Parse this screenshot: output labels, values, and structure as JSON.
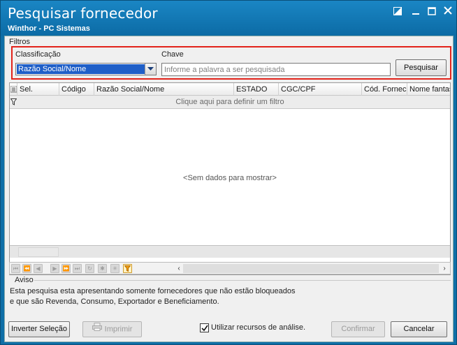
{
  "window": {
    "title": "Pesquisar fornecedor",
    "subtitle": "Winthor - PC Sistemas",
    "controls": {
      "restore": "◩",
      "minimize": "—",
      "maximize": "☐",
      "close": "✕"
    }
  },
  "filtros": {
    "group_label": "Filtros",
    "classificacao_label": "Classificação",
    "classificacao_value": "Razão Social/Nome",
    "chave_label": "Chave",
    "chave_placeholder": "Informe a palavra a ser pesquisada",
    "chave_value": "",
    "pesquisar_label": "Pesquisar"
  },
  "grid": {
    "columns": [
      "Sel.",
      "Código",
      "Razão Social/Nome",
      "ESTADO",
      "CGC/CPF",
      "Cód. Fornec",
      "Nome fantasia"
    ],
    "filter_prompt": "Clique aqui para definir um filtro",
    "empty_message": "<Sem dados para mostrar>",
    "rows": []
  },
  "navigator": {
    "buttons": [
      "⏮",
      "⏪",
      "◀",
      "▶",
      "⏩",
      "⏭",
      "↻",
      "✱",
      "✳",
      "filter"
    ]
  },
  "aviso": {
    "label": "Aviso",
    "line1": "Esta pesquisa esta apresentando somente fornecedores que não estão bloqueados",
    "line2": "e que são Revenda, Consumo, Exportador e Beneficiamento."
  },
  "footer": {
    "inverter_label": "Inverter Seleção",
    "imprimir_label": "Imprimir",
    "analise_label": "Utilizar recursos de análise.",
    "analise_checked": true,
    "confirmar_label": "Confirmar",
    "cancelar_label": "Cancelar"
  },
  "colors": {
    "titlebar": "#0c6ba5",
    "highlight_border": "#e2231a",
    "selection": "#1f5fc8"
  }
}
